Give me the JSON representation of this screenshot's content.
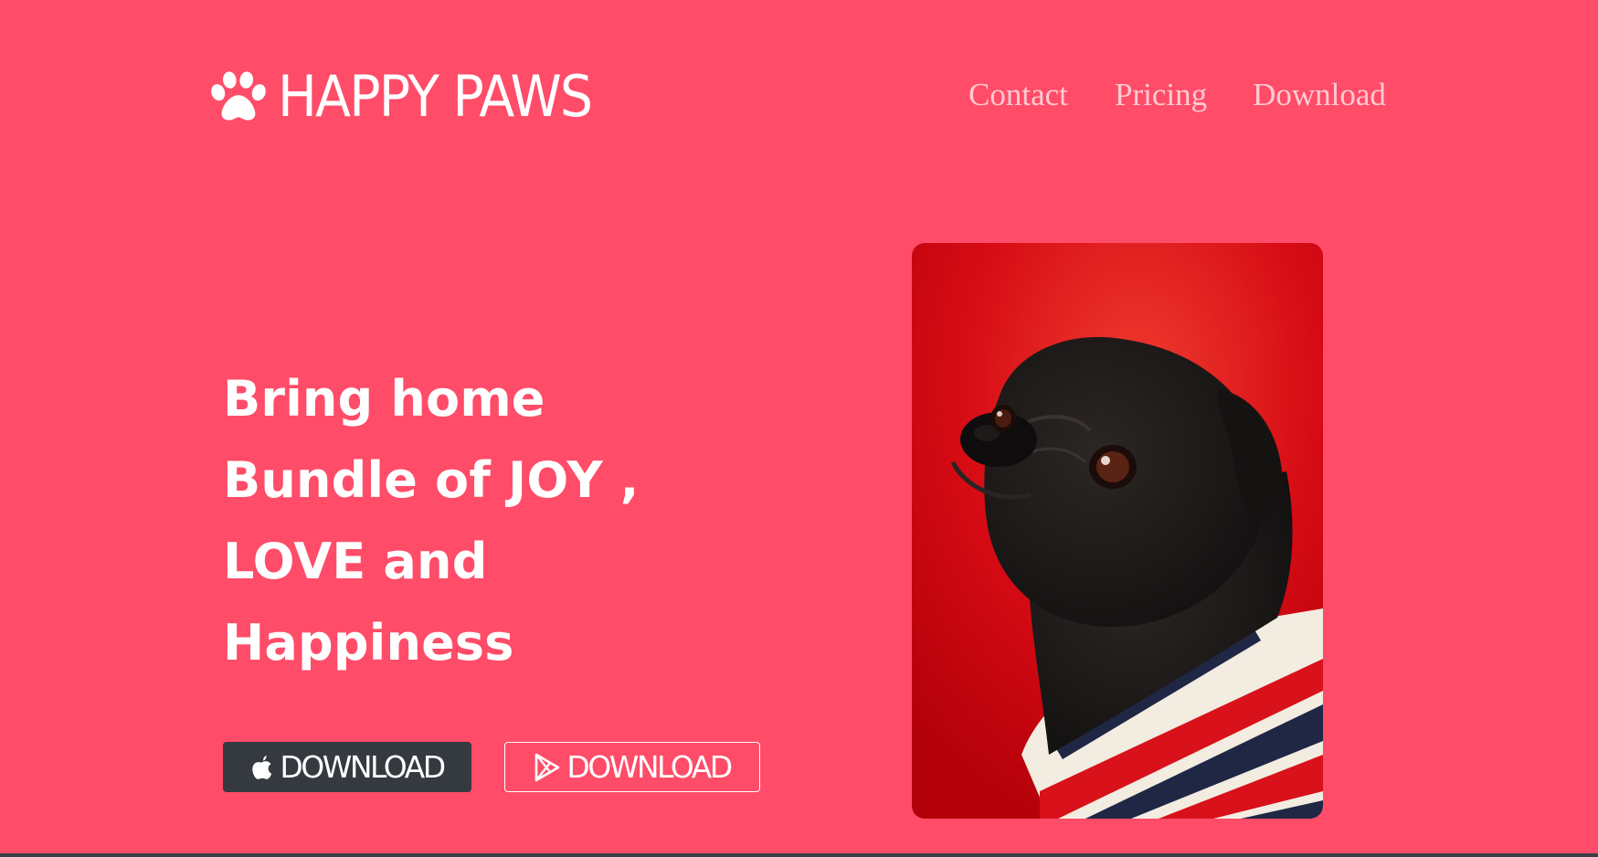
{
  "brand": {
    "name": "HAPPY PAWS",
    "logo_icon": "paw-icon"
  },
  "nav": {
    "links": [
      "Contact",
      "Pricing",
      "Download"
    ]
  },
  "hero": {
    "title_lines": [
      "Bring home",
      "Bundle of JOY ,",
      "LOVE and",
      "Happiness"
    ]
  },
  "buttons": {
    "ios": {
      "label": "DOWNLOAD",
      "icon": "apple-icon"
    },
    "play": {
      "label": "DOWNLOAD",
      "icon": "play-store-icon"
    }
  },
  "image": {
    "subject": "pug-photo"
  },
  "colors": {
    "background": "#ff4c68",
    "dark_button": "#343a40",
    "nav_text": "#ffd6dc"
  }
}
